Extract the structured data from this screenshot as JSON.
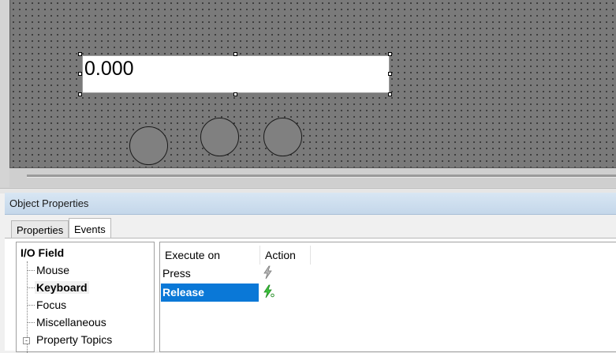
{
  "canvas": {
    "io_field": {
      "value": "0.000"
    },
    "buttons": [
      "circle-button-1",
      "circle-button-2",
      "circle-button-3"
    ]
  },
  "object_properties": {
    "title": "Object Properties",
    "tabs": [
      {
        "label": "Properties",
        "active": false
      },
      {
        "label": "Events",
        "active": true
      }
    ],
    "tree": {
      "root": "I/O Field",
      "items": [
        {
          "label": "Mouse",
          "selected": false
        },
        {
          "label": "Keyboard",
          "selected": true
        },
        {
          "label": "Focus",
          "selected": false
        },
        {
          "label": "Miscellaneous",
          "selected": false
        },
        {
          "label": "Property Topics",
          "selected": false,
          "expander": "-"
        }
      ]
    },
    "events_table": {
      "columns": [
        "Execute on",
        "Action"
      ],
      "rows": [
        {
          "label": "Press",
          "selected": false,
          "action_icon": "lightning-gray-icon"
        },
        {
          "label": "Release",
          "selected": true,
          "action_icon": "lightning-green-icon"
        }
      ]
    }
  },
  "colors": {
    "selection": "#0a78d7",
    "canvas_bg": "#7a7a7a",
    "header_bg": "#c4d7ea",
    "action_active": "#3cc43c"
  }
}
